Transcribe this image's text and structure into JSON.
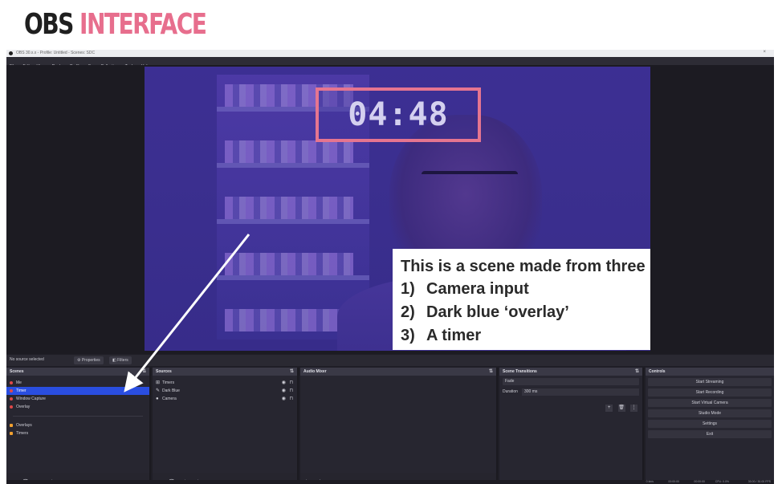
{
  "slide": {
    "title_part1": "OBS",
    "title_part2": "INTERFACE"
  },
  "window": {
    "title": "OBS 30.x.x - Profile: Untitled - Scenes: SDC",
    "menu": [
      "File",
      "Edit",
      "View",
      "Docks",
      "Profile",
      "Scene Collection",
      "Tools",
      "Help"
    ]
  },
  "preview": {
    "timer": "04:48",
    "callout": {
      "heading": "This is a scene made from three sources:",
      "items": [
        {
          "num": "1)",
          "text": "Camera input"
        },
        {
          "num": "2)",
          "text": "Dark blue ‘overlay’"
        },
        {
          "num": "3)",
          "text": "A timer"
        }
      ]
    }
  },
  "status_strip": {
    "no_source": "No source selected",
    "properties": "Properties",
    "filters": "Filters"
  },
  "scenes": {
    "header": "Scenes",
    "items": [
      {
        "label": "Me",
        "type": "scene",
        "selected": false
      },
      {
        "label": "Timer",
        "type": "scene",
        "selected": true
      },
      {
        "label": "Window Capture",
        "type": "scene",
        "selected": false
      },
      {
        "label": "Overlay",
        "type": "scene",
        "selected": false
      },
      {
        "label": "Overlays",
        "type": "group",
        "selected": false
      },
      {
        "label": "Timers",
        "type": "group",
        "selected": false
      }
    ],
    "footer_icons": [
      "+",
      "🗑",
      "▤",
      "⌃",
      "⌄"
    ]
  },
  "sources": {
    "header": "Sources",
    "items": [
      {
        "label": "Timers",
        "icon": "⊞"
      },
      {
        "label": "Dark Blue",
        "icon": "✎"
      },
      {
        "label": "Camera",
        "icon": "●"
      }
    ],
    "footer_icons": [
      "+",
      "🗑",
      "⚙",
      "⌃",
      "⌄"
    ]
  },
  "audio_mixer": {
    "header": "Audio Mixer",
    "footer_icons": [
      "✎",
      "⋮"
    ]
  },
  "scene_transitions": {
    "header": "Scene Transitions",
    "transition": "Fade",
    "duration_label": "Duration",
    "duration_value": "300 ms",
    "buttons": [
      "+",
      "🗑",
      "⋮"
    ]
  },
  "controls": {
    "header": "Controls",
    "buttons": [
      "Start Streaming",
      "Start Recording",
      "Start Virtual Camera",
      "Studio Mode",
      "Settings",
      "Exit"
    ]
  },
  "statusbar": {
    "items": [
      "0 kb/s",
      "00:00:00",
      "00:00:00",
      "CPU: 0.0%",
      "30.00 / 30.00 FPS"
    ]
  },
  "colors": {
    "accent_pink": "#e76e8d",
    "selected_blue": "#2a4ee0",
    "overlay_blue": "#3c2f93"
  }
}
